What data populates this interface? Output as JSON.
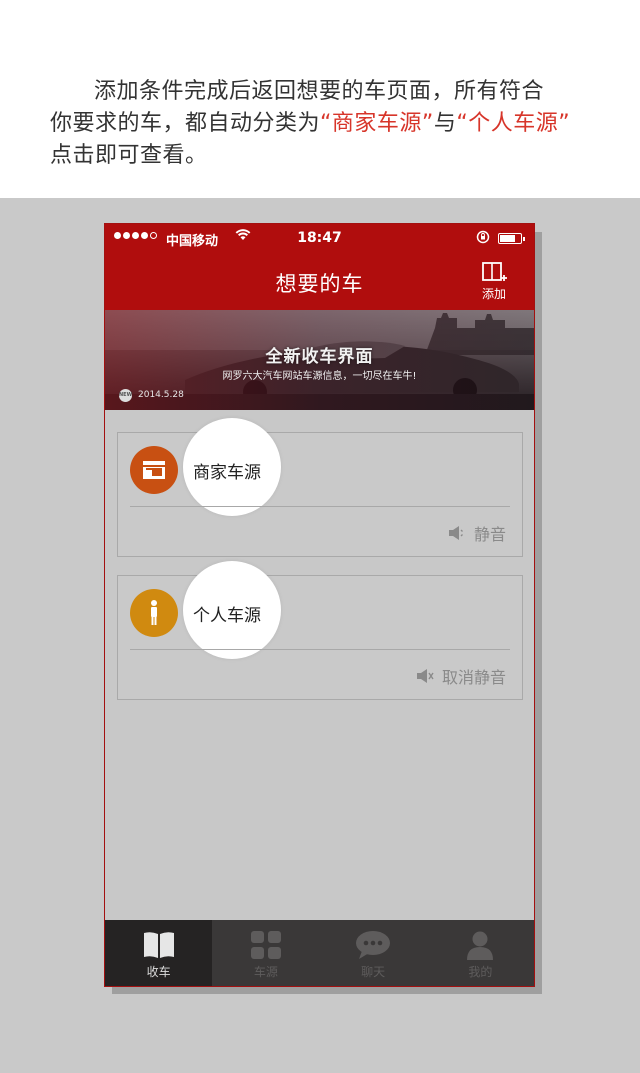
{
  "intro": {
    "line1": "添加条件完成后返回想要的车页面，所有符合",
    "line2_prefix": "你要求的车，都自动分类为",
    "highlight1": "“商家车源”",
    "joiner": "与",
    "highlight2": "“个人车源”",
    "line3": "点击即可查看。",
    "highlight_color": "#d7352a"
  },
  "status_bar": {
    "carrier": "中国移动",
    "time": "18:47"
  },
  "nav": {
    "title": "想要的车",
    "add_label": "添加"
  },
  "banner": {
    "title": "全新收车界面",
    "subtitle": "网罗六大汽车网站车源信息，一切尽在车牛!",
    "badge": "NEW",
    "date": "2014.5.28"
  },
  "sources": [
    {
      "label": "商家车源",
      "action": "静音",
      "icon": "storefront-icon",
      "color": "#c85012"
    },
    {
      "label": "个人车源",
      "action": "取消静音",
      "icon": "person-icon",
      "color": "#d08a10"
    }
  ],
  "tabs": [
    {
      "label": "收车",
      "icon": "book-icon",
      "active": true
    },
    {
      "label": "车源",
      "icon": "grid-icon",
      "active": false
    },
    {
      "label": "聊天",
      "icon": "chat-bubble-icon",
      "active": false
    },
    {
      "label": "我的",
      "icon": "user-icon",
      "active": false
    }
  ],
  "colors": {
    "brand_red": "#b00d0d",
    "tabbar": "#3a3838"
  }
}
